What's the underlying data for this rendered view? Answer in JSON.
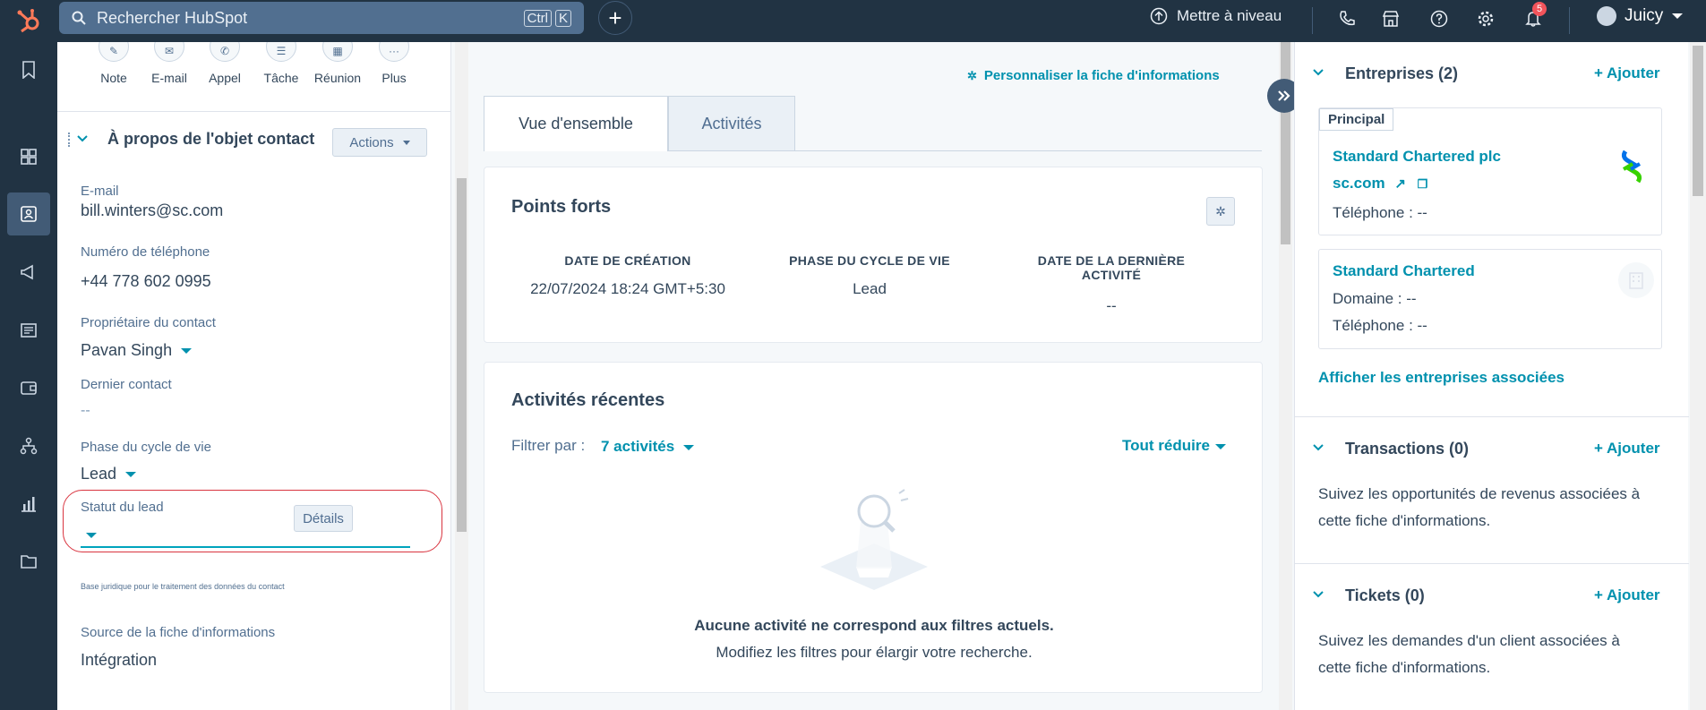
{
  "topbar": {
    "search_placeholder": "Rechercher HubSpot",
    "kbd_ctrl": "Ctrl",
    "kbd_k": "K",
    "upgrade": "Mettre à niveau",
    "notifications_count": "5",
    "account_name": "Juicy"
  },
  "quick_actions": [
    {
      "label": "Note",
      "icon": "note-icon"
    },
    {
      "label": "E-mail",
      "icon": "email-icon"
    },
    {
      "label": "Appel",
      "icon": "phone-icon"
    },
    {
      "label": "Tâche",
      "icon": "task-icon"
    },
    {
      "label": "Réunion",
      "icon": "meeting-icon"
    },
    {
      "label": "Plus",
      "icon": "more-icon"
    }
  ],
  "about": {
    "title": "À propos de l'objet contact",
    "actions_label": "Actions",
    "fields": {
      "email_label": "E-mail",
      "email_value": "bill.winters@sc.com",
      "phone_label": "Numéro de téléphone",
      "phone_value": "+44 778 602 0995",
      "owner_label": "Propriétaire du contact",
      "owner_value": "Pavan Singh",
      "last_contact_label": "Dernier contact",
      "last_contact_value": "--",
      "lifecycle_label": "Phase du cycle de vie",
      "lifecycle_value": "Lead",
      "lead_status_label": "Statut du lead",
      "details_label": "Détails",
      "legal_basis_label": "Base juridique pour le traitement des données du contact",
      "source_label": "Source de la fiche d'informations",
      "source_value": "Intégration"
    }
  },
  "middle": {
    "customize_label": "Personnaliser la fiche d'informations",
    "tabs": [
      "Vue d'ensemble",
      "Activités"
    ],
    "highlights": {
      "title": "Points forts",
      "created_label": "DATE DE CRÉATION",
      "created_value": "22/07/2024 18:24 GMT+5:30",
      "lifecycle_label": "PHASE DU CYCLE DE VIE",
      "lifecycle_value": "Lead",
      "last_activity_label_1": "DATE DE LA DERNIÈRE",
      "last_activity_label_2": "ACTIVITÉ",
      "last_activity_value": "--"
    },
    "recent": {
      "title": "Activités récentes",
      "filter_label": "Filtrer par :",
      "filter_value": "7 activités",
      "collapse_label": "Tout réduire",
      "empty_title": "Aucune activité ne correspond aux filtres actuels.",
      "empty_sub": "Modifiez les filtres pour élargir votre recherche."
    }
  },
  "right": {
    "companies": {
      "title": "Entreprises (2)",
      "add": "+ Ajouter",
      "principal": "Principal",
      "cards": [
        {
          "name": "Standard Chartered plc",
          "domain": "sc.com",
          "phone": "Téléphone : --"
        },
        {
          "name": "Standard Chartered",
          "domain": "Domaine : --",
          "phone": "Téléphone : --"
        }
      ],
      "view_all": "Afficher les entreprises associées"
    },
    "deals": {
      "title": "Transactions (0)",
      "add": "+ Ajouter",
      "desc_1": "Suivez les opportunités de revenus associées à",
      "desc_2": "cette fiche d'informations."
    },
    "tickets": {
      "title": "Tickets (0)",
      "add": "+ Ajouter",
      "desc_1": "Suivez les demandes d'un client associées à",
      "desc_2": "cette fiche d'informations."
    }
  },
  "colors": {
    "nav_bg": "#213343",
    "link": "#0091ae",
    "highlight_border": "#d9343f"
  }
}
